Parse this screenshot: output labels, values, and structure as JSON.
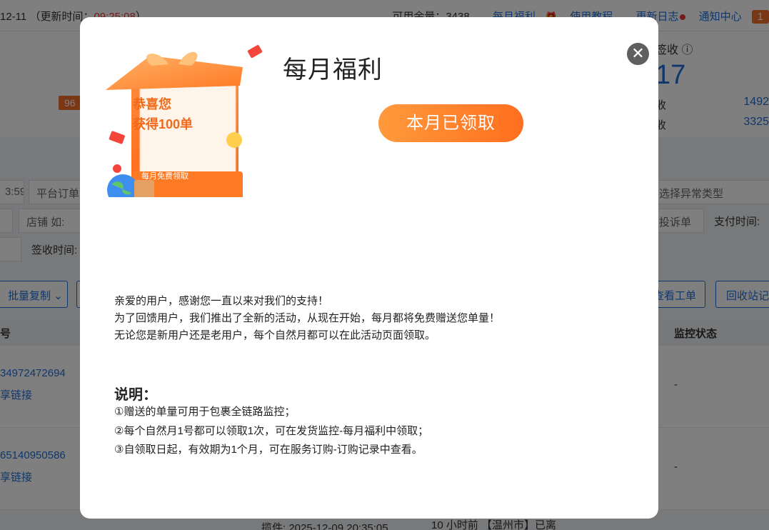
{
  "topbar": {
    "date": "12-11",
    "update_label": "（更新时间：",
    "update_time": "09:25:08",
    "update_close": "）",
    "balance": "可用余量：3438",
    "monthly_welfare": "每月福利",
    "tutorial": "使用教程",
    "changelog": "更新日志",
    "notifications": "通知中心",
    "notif_count": "1"
  },
  "stats": {
    "tag": "96",
    "sign_title": "签收",
    "big_number": "17",
    "row1_label": "收",
    "row1_value": "1492",
    "row2_label": "收",
    "row2_value": "3325"
  },
  "filters": {
    "time_fragment": "3:59:",
    "platform_order": "平台订单",
    "exception_type": "选择异常类型",
    "shop_placeholder": "店铺 如: ",
    "complaint": "投诉单",
    "pay_time": "支付时间:",
    "sign_time": "签收时间:",
    "batch_copy": "批量复制",
    "view_ticket": "查看工单",
    "recycle": "回收站记"
  },
  "table": {
    "col_no": "号",
    "col_monitor": "监控状态",
    "rows": [
      {
        "id": "34972472694",
        "share": "享链接",
        "status": "-"
      },
      {
        "id": "65140950586",
        "share": "享链接",
        "status": "-"
      }
    ],
    "partial_pickup": "揽件:  2025-12-09 20:35:05",
    "partial_track": "10 小时前 【温州市】已离"
  },
  "modal": {
    "title": "每月福利",
    "claim_button": "本月已领取",
    "gift_line1": "恭喜您",
    "gift_line2": "获得100单",
    "gift_sub": "每月免费领取",
    "intro": [
      "亲爱的用户，感谢您一直以来对我们的支持！",
      "为了回馈用户，我们推出了全新的活动，从现在开始，每月都将免费赠送您单量！",
      "无论您是新用户还是老用户，每个自然月都可以在此活动页面领取。"
    ],
    "notes_title": "说明：",
    "notes": [
      "①赠送的单量可用于包裹全链路监控；",
      "②每个自然月1号都可以领取1次，可在发货监控-每月福利中领取；",
      "③自领取日起，有效期为1个月，可在服务订购-订购记录中查看。"
    ]
  },
  "colors": {
    "accent_orange": "#ff7a24",
    "link_blue": "#1f6fd8",
    "overlay": "rgba(0,0,0,0.5)"
  }
}
